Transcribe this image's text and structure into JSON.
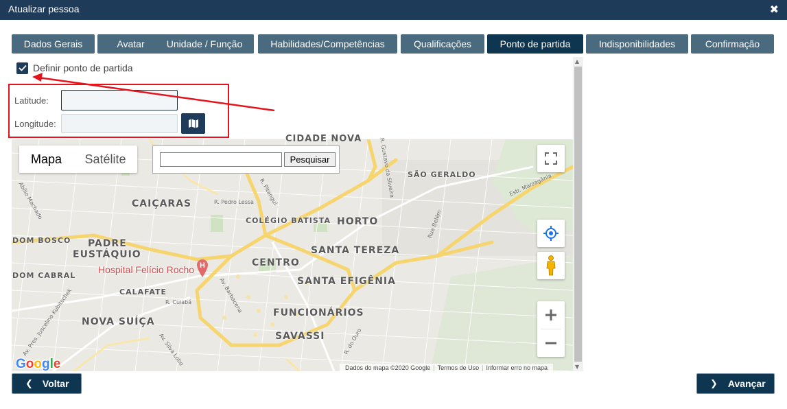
{
  "window": {
    "title": "Atualizar pessoa",
    "close_glyph": "✖"
  },
  "tabs": [
    {
      "label": "Dados Gerais",
      "active": false
    },
    {
      "label": "Avatar",
      "active": false
    },
    {
      "label": "Unidade / Função",
      "active": false
    },
    {
      "label": "Habilidades/Competências",
      "active": false
    },
    {
      "label": "Qualificações",
      "active": false
    },
    {
      "label": "Ponto de partida",
      "active": true
    },
    {
      "label": "Indisponibilidades",
      "active": false
    },
    {
      "label": "Confirmação",
      "active": false
    }
  ],
  "form": {
    "checkbox_label": "Definir ponto de partida",
    "checkbox_checked": true,
    "latitude_label": "Latitude:",
    "latitude_value": "",
    "longitude_label": "Longitude:",
    "longitude_value": ""
  },
  "map": {
    "type_map": "Mapa",
    "type_satellite": "Satélite",
    "search_value": "",
    "search_button": "Pesquisar",
    "labels": {
      "cidade_nova": "CIDADE NOVA",
      "sao_geraldo": "SÃO GERALDO",
      "caicaras": "CAIÇARAS",
      "colegio_batista": "COLÉGIO BATISTA",
      "horto": "HORTO",
      "dom_bosco": "DOM BOSCO",
      "padre": "PADRE",
      "eustaquio": "EUSTÁQUIO",
      "santa_tereza": "SANTA TEREZA",
      "centro": "CENTRO",
      "dom_cabral": "DOM CABRAL",
      "santa_efigenia": "SANTA EFIGÊNIA",
      "calafate": "CALAFATE",
      "funcionarios": "FUNCIONÁRIOS",
      "nova_suica": "NOVA SUÍÇA",
      "savassi": "SAVASSI"
    },
    "streets": {
      "pedro_lessa": "R. Pedro Lessa",
      "pitangui": "R. Pitangui",
      "cuiaba": "R. Cuiabá",
      "barbacena": "Av. Barbacena",
      "belem": "Rua Belém",
      "gustavo": "R. Gustavo da Silveira",
      "marzagania": "Estr. Marzagânia",
      "abilio": "Abílio Machado",
      "silva_lobo": "Av. Silva Lobo",
      "do_ouro": "R. do Ouro",
      "juscelino": "Av. Pres. Juscelino Kubitschek"
    },
    "hospital": "Hospital Felício Rocho",
    "google": "Google",
    "attribution": {
      "data": "Dados do mapa ©2020 Google",
      "terms": "Termos de Uso",
      "report": "Informar erro no mapa"
    }
  },
  "footer": {
    "back": "Voltar",
    "next": "Avançar"
  },
  "colors": {
    "header": "#1f3b5a",
    "tab": "#4a6a7f",
    "tab_active": "#0f3650",
    "highlight": "#e5131b",
    "road_major": "#f6d56e"
  }
}
